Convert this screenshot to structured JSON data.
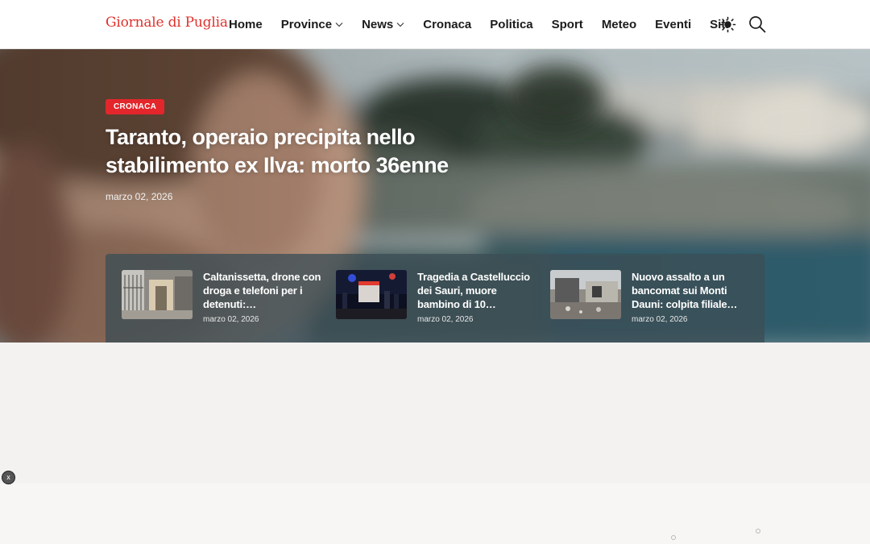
{
  "site": {
    "logo": "Giornale di Puglia"
  },
  "nav": {
    "items": [
      {
        "label": "Home",
        "dropdown": false
      },
      {
        "label": "Province",
        "dropdown": true
      },
      {
        "label": "News",
        "dropdown": true
      },
      {
        "label": "Cronaca",
        "dropdown": false
      },
      {
        "label": "Politica",
        "dropdown": false
      },
      {
        "label": "Sport",
        "dropdown": false
      },
      {
        "label": "Meteo",
        "dropdown": false
      },
      {
        "label": "Eventi",
        "dropdown": false
      },
      {
        "label": "Siti",
        "dropdown": false
      }
    ],
    "theme_icon": "sun-icon",
    "search_icon": "search-icon"
  },
  "hero": {
    "category": "CRONACA",
    "title": "Taranto, operaio precipita nello stabilimento ex Ilva: morto 36enne",
    "date": "marzo 02, 2026"
  },
  "related": [
    {
      "title": "Caltanissetta, drone con droga e telefoni per i detenuti:…",
      "date": "marzo 02, 2026"
    },
    {
      "title": "Tragedia a Castelluccio dei Sauri, muore bambino di 10…",
      "date": "marzo 02, 2026"
    },
    {
      "title": "Nuovo assalto a un bancomat sui Monti Dauni: colpita filiale…",
      "date": "marzo 02, 2026"
    }
  ],
  "ad": {
    "close_label": "x"
  },
  "colors": {
    "brand": "#e0312b",
    "badge": "#e3262b",
    "related_panel": "#3c4e56"
  }
}
